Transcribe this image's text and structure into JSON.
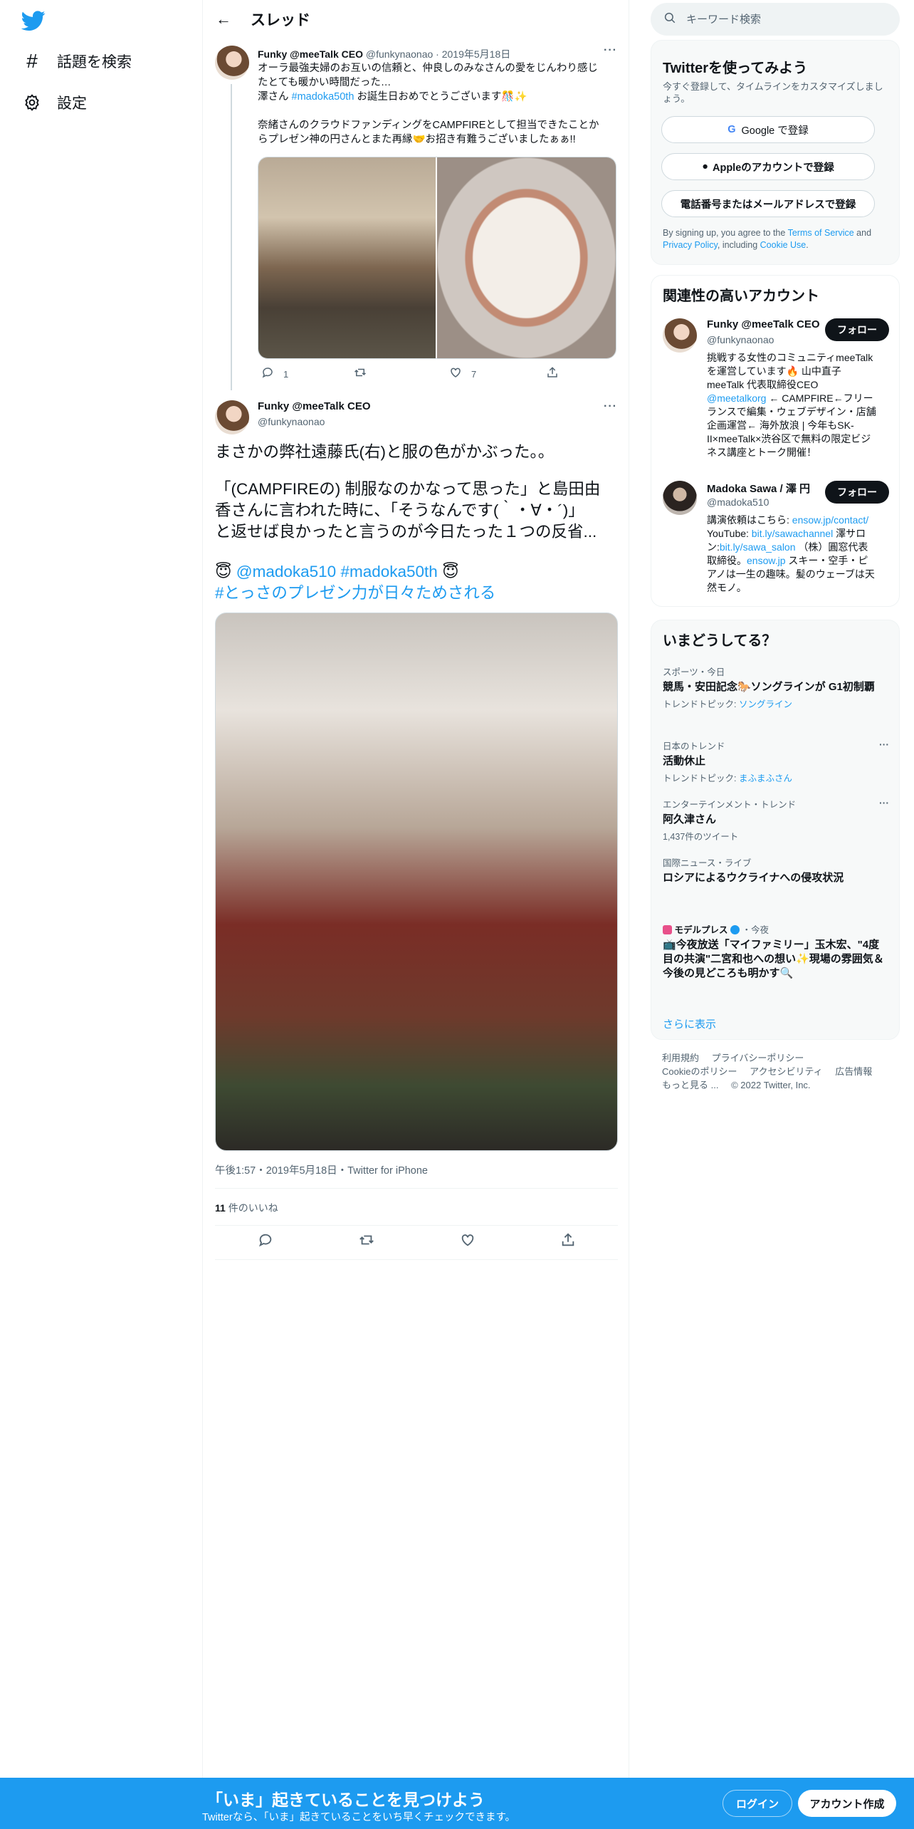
{
  "nav": {
    "logo_icon": "twitter-bird-icon",
    "items": [
      {
        "label": "話題を検索",
        "icon": "hashtag-icon"
      },
      {
        "label": "設定",
        "icon": "gear-icon"
      }
    ]
  },
  "thread": {
    "title": "スレッド",
    "tweet1": {
      "name": "Funky @meeTalk CEO",
      "handle": "@funkynaonao",
      "date": "2019年5月18日",
      "text_lines": [
        "オーラ最強夫婦のお互いの信頼と、仲良しのみなさんの愛をじんわり感じ",
        "たとても暖かい時間だった…",
        "澤さん",
        "#madoka50th",
        "お誕生日おめでとうございます🎊✨",
        "奈緒さんのクラウドファンディングをCAMPFIREとして担当できたことか",
        "らプレゼン神の円さんとまた再縁🤝お招き有難うございましたぁぁ!!"
      ],
      "reply_count": "1",
      "like_count": "7"
    },
    "tweet2": {
      "name": "Funky @meeTalk CEO",
      "handle": "@funkynaonao",
      "text_lines": [
        "まさかの弊社遠藤氏(右)と服の色がかぶった。。",
        "「(CAMPFIREの) 制服なのかなって思った」と島田由",
        "香さんに言われた時に、「そうなんです(｀・∀・´)」",
        "と返せば良かったと言うのが今日たった１つの反省..."
      ],
      "tag_lines": {
        "emoji1": "😇",
        "mention": "@madoka510",
        "hashtag1": "#madoka50th",
        "emoji2": "😇",
        "hashtag2": "#とっさのプレゼン力が日々ためされる"
      },
      "meta": "午後1:57・2019年5月18日・Twitter for iPhone",
      "likes_count": "11",
      "likes_label": " 件のいいね"
    }
  },
  "search": {
    "placeholder": "キーワード検索"
  },
  "signup": {
    "title": "Twitterを使ってみよう",
    "subtitle": "今すぐ登録して、タイムラインをカスタマイズしましょう。",
    "google": "Google で登録",
    "apple": "Appleのアカウントで登録",
    "phone": "電話番号またはメールアドレスで登録",
    "legal_pre": "By signing up, you agree to the ",
    "terms": "Terms of Service",
    "legal_and": " and ",
    "privacy": "Privacy Policy",
    "legal_mid": ", including ",
    "cookie": "Cookie Use",
    "legal_end": "."
  },
  "related": {
    "title": "関連性の高いアカウント",
    "follow_label": "フォロー",
    "accounts": [
      {
        "name": "Funky @meeTalk CEO",
        "handle": "@funkynaonao",
        "bio_lines": [
          "挑戦する女性のコミュニティmeeTalk",
          "を運営しています🔥 山中直子",
          "meeTalk 代表取締役CEO",
          "@meetalkorg",
          " ← CAMPFIRE←フリー",
          "ランスで編集・ウェブデザイン・店舗",
          "企画運営← 海外放浪 | 今年もSK-",
          "II×meeTalk×渋谷区で無料の限定ビジ",
          "ネス講座とトーク開催！"
        ]
      },
      {
        "name": "Madoka Sawa / 澤 円",
        "handle": "@madoka510",
        "bio_lines": [
          "講演依頼はこちら: ",
          "ensow.jp/contact/",
          "YouTube: ",
          "bit.ly/sawachannel",
          " 澤サロ",
          "ン:",
          "bit.ly/sawa_salon",
          " （株）圓窓代表",
          "取締役。",
          "ensow.jp",
          " スキー・空手・ピ",
          "アノは一生の趣味。髪のウェーブは天",
          "然モノ。"
        ]
      }
    ]
  },
  "trends": {
    "title": "いまどうしてる？",
    "items": [
      {
        "meta": "スポーツ・今日",
        "name": "競馬・安田記念🐎ソングラインが G1初制覇",
        "sub_label": "トレンドトピック: ",
        "sub_link": "ソングライン"
      },
      {
        "meta": "日本のトレンド",
        "name": "活動休止",
        "sub_label": "トレンドトピック: ",
        "sub_link": "まふまふさん"
      },
      {
        "meta": "エンターテインメント・トレンド",
        "name": "阿久津さん",
        "sub_label": "1,437件のツイート",
        "sub_link": ""
      },
      {
        "meta": "国際ニュース・ライブ",
        "name": "ロシアによるウクライナへの侵攻状況",
        "sub_label": "",
        "sub_link": ""
      },
      {
        "meta_source": "モデルプレス",
        "meta_time": "・今夜",
        "name": "📺今夜放送「マイファミリー」玉木宏、\"4度目の共演\"二宮和也への想い✨現場の雰囲気＆今後の見どころも明かす🔍"
      }
    ],
    "show_more": "さらに表示"
  },
  "footer": {
    "links": [
      "利用規約",
      "プライバシーポリシー",
      "Cookieのポリシー",
      "アクセシビリティ",
      "広告情報",
      "もっと見る ..."
    ],
    "copyright": "© 2022 Twitter, Inc."
  },
  "bottombar": {
    "title": "「いま」起きていることを見つけよう",
    "subtitle": "Twitterなら、「いま」起きていることをいち早くチェックできます。",
    "login": "ログイン",
    "signup": "アカウント作成"
  },
  "colors": {
    "accent": "#1d9bf0",
    "text": "#0f1419",
    "muted": "#536471"
  }
}
